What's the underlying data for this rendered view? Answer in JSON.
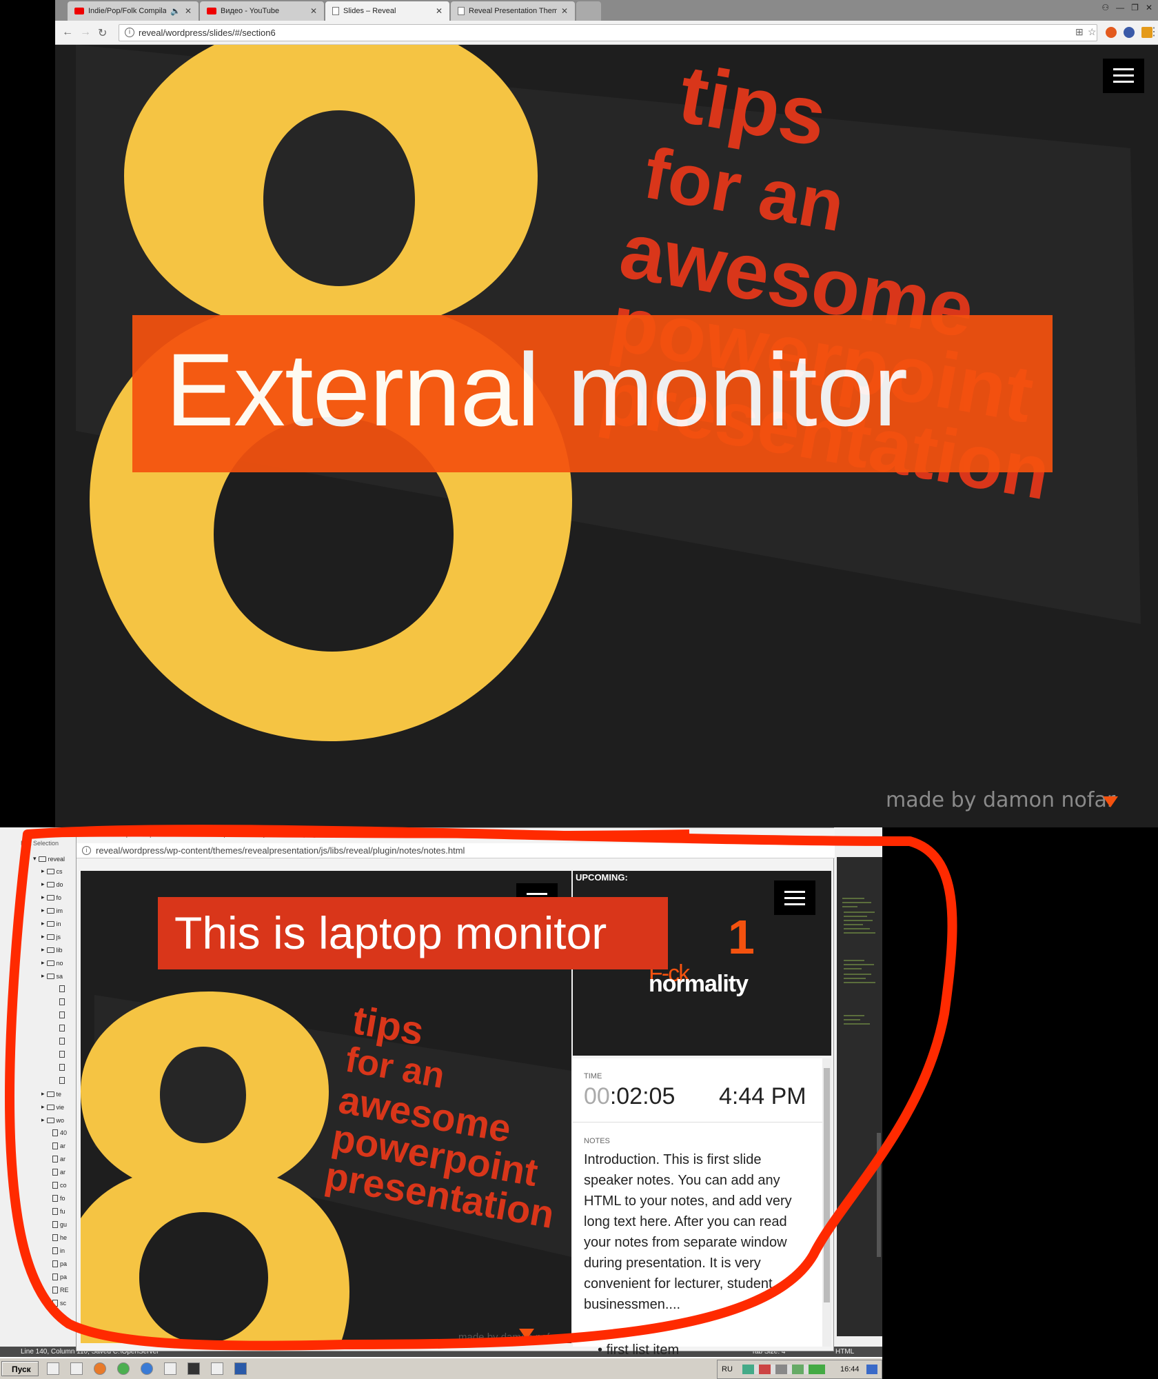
{
  "top_browser": {
    "tabs": [
      {
        "label": "Indie/Pop/Folk Compilat",
        "icon": "youtube-icon"
      },
      {
        "label": "Видео - YouTube",
        "icon": "youtube-icon"
      },
      {
        "label": "Slides – Reveal",
        "icon": "page-icon"
      },
      {
        "label": "Reveal Presentation Theme",
        "icon": "page-icon"
      }
    ],
    "url": "reveal/wordpress/slides/#/section6"
  },
  "main_slide": {
    "banner_text": "External monitor",
    "big_digit": "8",
    "tips_lines": [
      "tips",
      "for an",
      "awesome",
      "powerpoint",
      "presentation"
    ],
    "credit": "made by damon nofar",
    "colors": {
      "accent": "#f4520f",
      "yellow": "#f5c443",
      "background": "#1e1e1e"
    }
  },
  "notes_window": {
    "title": "reveal/wordpress/wp-content/themes/revealpresentation/js/libs/reveal/plugin/notes/notes.html - Google Chrome",
    "url": "reveal/wordpress/wp-content/themes/revealpresentation/js/libs/reveal/plugin/notes/notes.html",
    "current_slide": {
      "banner_text": "This is laptop monitor",
      "big_digit": "8",
      "tips_lines": [
        "tips",
        "for an",
        "awesome",
        "powerpoint",
        "presentation"
      ],
      "credit": "made by damon nofar"
    },
    "upcoming": {
      "label": "UPCOMING:",
      "number": "1",
      "fck": "F-ck",
      "normality": "normality"
    },
    "time": {
      "label": "TIME",
      "timer_hours": "00",
      "timer_rest": ":02:05",
      "clock": "4:44 PM"
    },
    "notes": {
      "label": "NOTES",
      "text": "Introduction. This is first slide speaker notes. You can add any HTML to your notes, and add very long text here. After you can read your notes from separate window during presentation. It is very convenient for lecturer, student, businessmen....",
      "first_list_item": "first list item"
    }
  },
  "editor": {
    "menu": "Edit   Selection",
    "root_folder": "reveal",
    "folders": [
      "cs",
      "do",
      "fo",
      "im",
      "in",
      "js",
      "lib",
      "no",
      "sa"
    ],
    "folders_after": [
      "te",
      "vie",
      "wo"
    ],
    "files_after": [
      "40",
      "ar",
      "ar",
      "ar",
      "co",
      "fo",
      "fu",
      "gu",
      "he",
      "in",
      "pa",
      "pa",
      "RE",
      "sc"
    ],
    "status_left": "Line 140, Column 110; Saved C:\\OpenServer",
    "status_tab": "Tab Size: 4",
    "status_lang": "HTML"
  },
  "taskbar": {
    "start_label": "Пуск",
    "lang": "RU",
    "time": "16:44"
  }
}
